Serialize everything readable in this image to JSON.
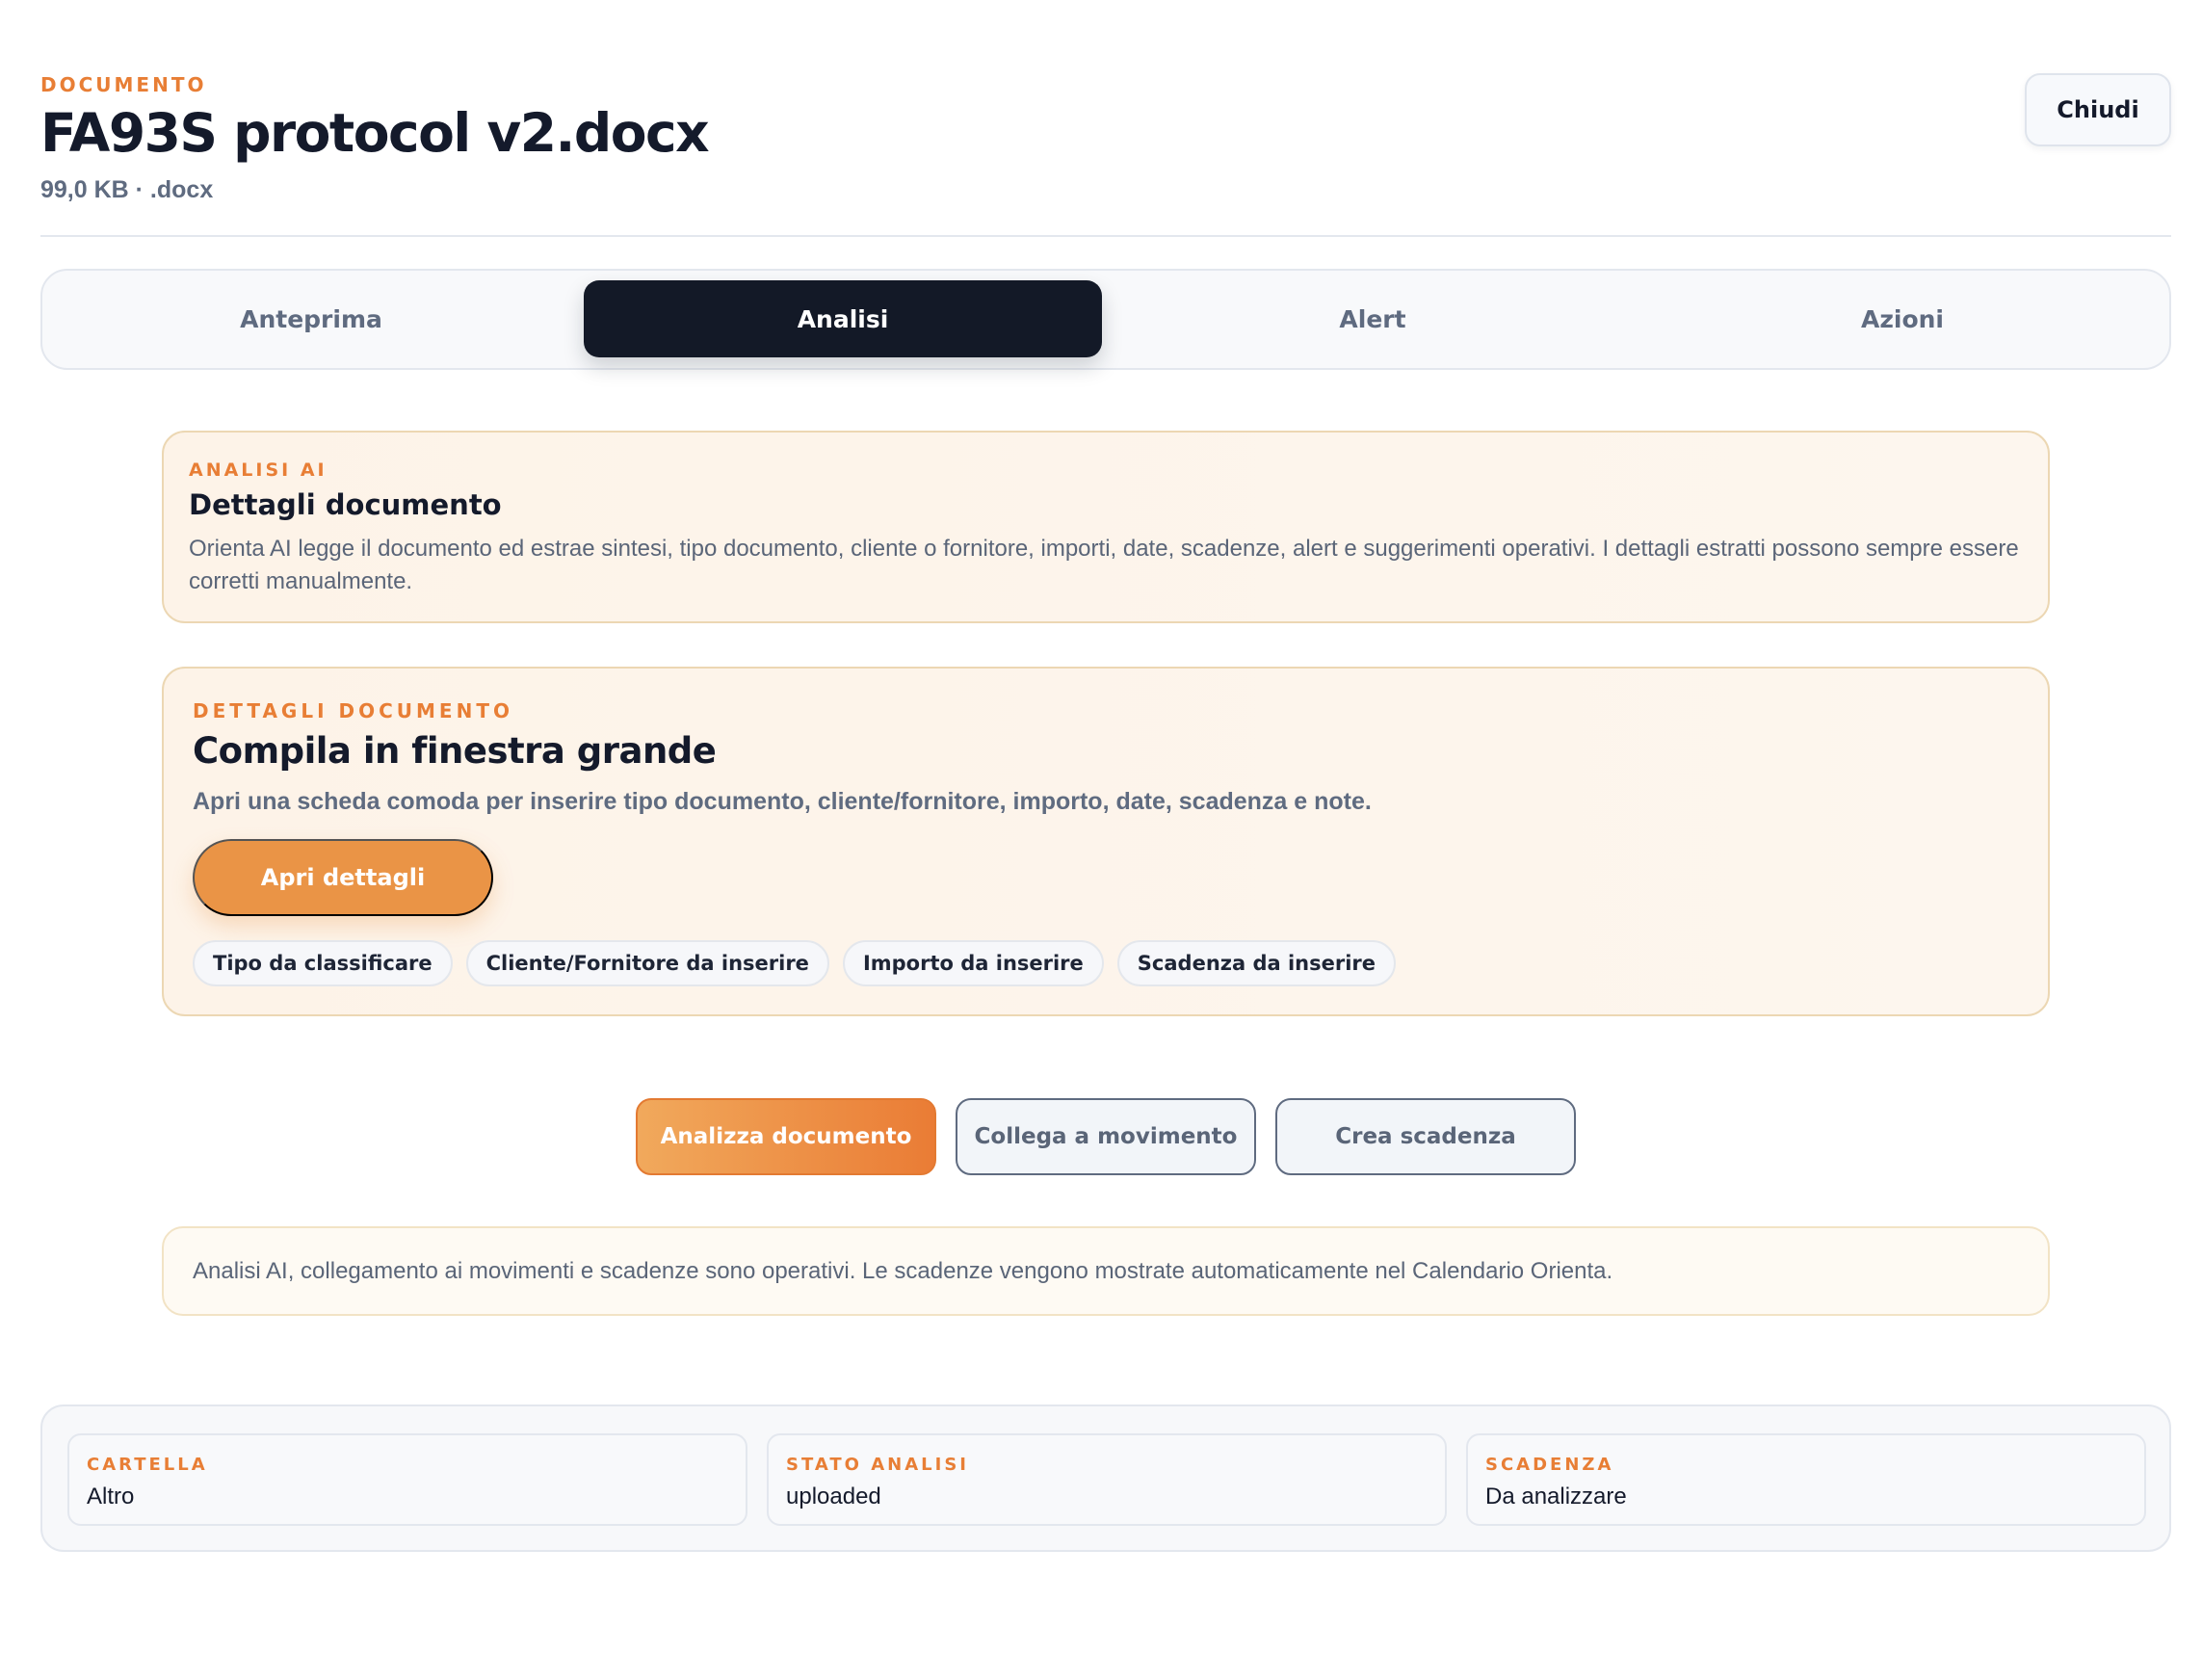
{
  "header": {
    "eyebrow": "DOCUMENTO",
    "title": "FA93S protocol v2.docx",
    "meta": "99,0 KB · .docx",
    "close_label": "Chiudi"
  },
  "tabs": [
    {
      "label": "Anteprima",
      "active": false
    },
    {
      "label": "Analisi",
      "active": true
    },
    {
      "label": "Alert",
      "active": false
    },
    {
      "label": "Azioni",
      "active": false
    }
  ],
  "ai_card": {
    "eyebrow": "ANALISI AI",
    "title": "Dettagli documento",
    "text": "Orienta AI legge il documento ed estrae sintesi, tipo documento, cliente o fornitore, importi, date, scadenze, alert e suggerimenti operativi. I dettagli estratti possono sempre essere corretti manualmente."
  },
  "details_card": {
    "eyebrow": "DETTAGLI DOCUMENTO",
    "title": "Compila in finestra grande",
    "text": "Apri una scheda comoda per inserire tipo documento, cliente/fornitore, importo, date, scadenza e note.",
    "button_label": "Apri dettagli",
    "chips": [
      "Tipo da classificare",
      "Cliente/Fornitore da inserire",
      "Importo da inserire",
      "Scadenza da inserire"
    ]
  },
  "actions": {
    "analyze_label": "Analizza documento",
    "link_label": "Collega a movimento",
    "deadline_label": "Crea scadenza"
  },
  "info": {
    "text": "Analisi AI, collegamento ai movimenti e scadenze sono operativi. Le scadenze vengono mostrate automaticamente nel Calendario Orienta."
  },
  "summary": [
    {
      "label": "CARTELLA",
      "value": "Altro"
    },
    {
      "label": "STATO ANALISI",
      "value": "uploaded"
    },
    {
      "label": "SCADENZA",
      "value": "Da analizzare"
    }
  ],
  "colors": {
    "accent": "#e87e35",
    "dark": "#131927",
    "muted": "#5f6b80"
  }
}
